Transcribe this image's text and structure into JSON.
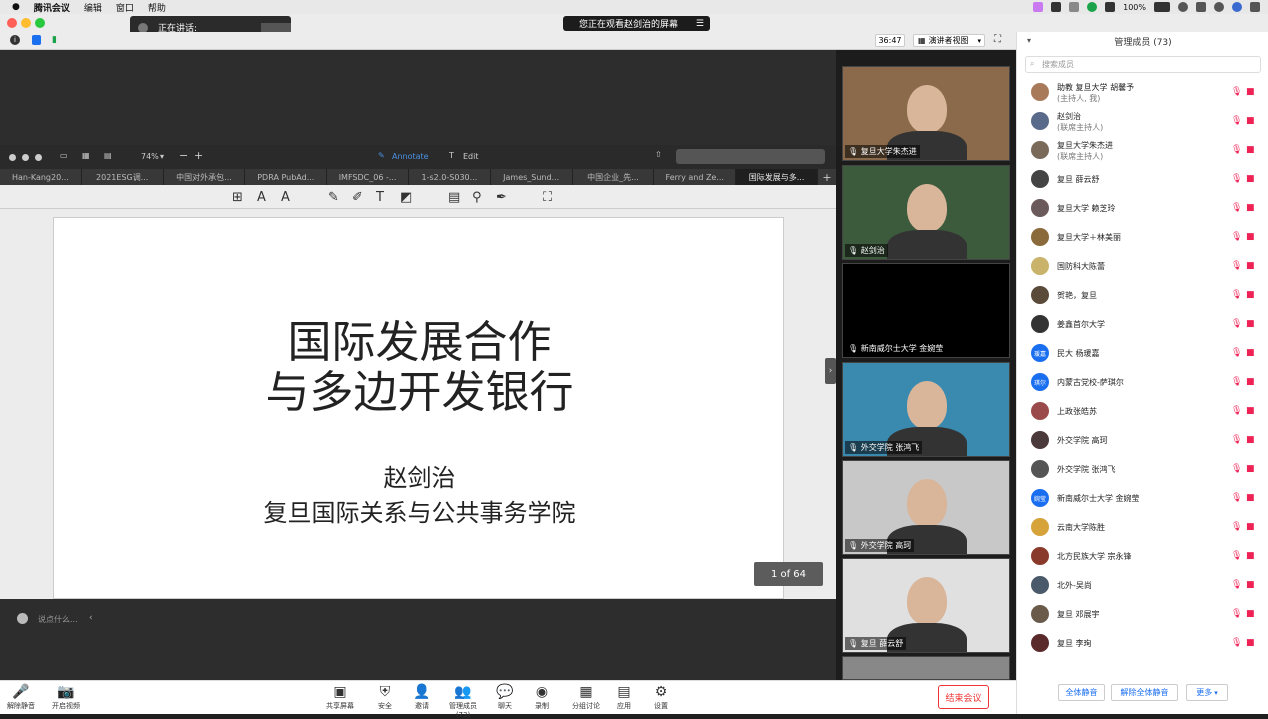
{
  "menubar": {
    "app": "腾讯会议",
    "items": [
      "编辑",
      "窗口",
      "帮助"
    ],
    "battery": "100%"
  },
  "speaking": {
    "label": "正在讲话:"
  },
  "viewing": {
    "text": "您正在观看赵剑治的屏幕"
  },
  "zoombar": {
    "timer": "36:47",
    "view_mode": "演讲者视图"
  },
  "preview": {
    "zoom": "74%",
    "annotate": "Annotate",
    "edit": "Edit",
    "tabs": [
      "Han-Kang20...",
      "2021ESG调...",
      "中国对外承包...",
      "PDRA PubAd...",
      "IMFSDC_06 -...",
      "1-s2.0-S030...",
      "James_Sund...",
      "中国企业_先...",
      "Ferry and Ze...",
      "国际发展与多..."
    ],
    "slide_title": "国际发展合作\n与多边开发银行",
    "slide_author": "赵剑治",
    "slide_school": "复旦国际关系与公共事务学院",
    "page": "1 of 64"
  },
  "chat": {
    "placeholder": "说点什么..."
  },
  "videos": [
    {
      "name": "复旦大学朱杰进",
      "mode": "person",
      "bg": "#8a6a4a"
    },
    {
      "name": "赵剑治",
      "mode": "person",
      "bg": "#3c5a3c"
    },
    {
      "name": "新南威尔士大学 金婉莹",
      "mode": "black",
      "bg": "#000000"
    },
    {
      "name": "外交学院 张鸿飞",
      "mode": "person",
      "bg": "#3a8ab0"
    },
    {
      "name": "外交学院 高珂",
      "mode": "person",
      "bg": "#c8c8c8"
    },
    {
      "name": "复旦 薛云舒",
      "mode": "person",
      "bg": "#e0e0e0"
    }
  ],
  "controls": [
    {
      "label": "解除静音",
      "icon": "mic-off-icon",
      "glyph": "🎤"
    },
    {
      "label": "开启视频",
      "icon": "video-off-icon",
      "glyph": "📷"
    },
    {
      "label": "共享屏幕",
      "icon": "share-screen-icon",
      "glyph": "▣"
    },
    {
      "label": "安全",
      "icon": "security-icon",
      "glyph": "⛨"
    },
    {
      "label": "邀请",
      "icon": "invite-icon",
      "glyph": "👤"
    },
    {
      "label": "管理成员(73)",
      "icon": "members-icon",
      "glyph": "👥"
    },
    {
      "label": "聊天",
      "icon": "chat-icon",
      "glyph": "💬"
    },
    {
      "label": "录制",
      "icon": "record-icon",
      "glyph": "◉"
    },
    {
      "label": "分组讨论",
      "icon": "breakout-icon",
      "glyph": "▦"
    },
    {
      "label": "应用",
      "icon": "apps-icon",
      "glyph": "▤"
    },
    {
      "label": "设置",
      "icon": "settings-icon",
      "glyph": "⚙"
    }
  ],
  "end_button": "结束会议",
  "panel": {
    "title": "管理成员 (73)",
    "search_placeholder": "搜索成员",
    "mute_all": "全体静音",
    "unmute_all": "解除全体静音",
    "more": "更多",
    "participants": [
      {
        "name": "助教 复旦大学 胡馨予",
        "role": "(主持人, 我)",
        "avatar": "",
        "color": "#a97a5a"
      },
      {
        "name": "赵剑治",
        "role": "(联席主持人)",
        "avatar": "",
        "color": "#5a6a8a"
      },
      {
        "name": "复旦大学朱杰进",
        "role": "(联席主持人)",
        "avatar": "",
        "color": "#7a6a5a"
      },
      {
        "name": "复旦 薛云舒",
        "role": "",
        "avatar": "",
        "color": "#444444"
      },
      {
        "name": "复旦大学 赖芝玲",
        "role": "",
        "avatar": "",
        "color": "#6a5a5a"
      },
      {
        "name": "复旦大学＋林美丽",
        "role": "",
        "avatar": "",
        "color": "#8a6a3a"
      },
      {
        "name": "国防科大陈蕾",
        "role": "",
        "avatar": "",
        "color": "#c9b26a"
      },
      {
        "name": "贺艳，复旦",
        "role": "",
        "avatar": "",
        "color": "#5a4a3a"
      },
      {
        "name": "姜鑫首尔大学",
        "role": "",
        "avatar": "",
        "color": "#333333"
      },
      {
        "name": "民大 杨瑗嘉",
        "role": "",
        "avatar": "瑗嘉",
        "color": "#1a6ef0"
      },
      {
        "name": "内蒙古党校-萨琪尔",
        "role": "",
        "avatar": "琪尔",
        "color": "#1a6ef0"
      },
      {
        "name": "上政张皓苏",
        "role": "",
        "avatar": "",
        "color": "#9a4a4a"
      },
      {
        "name": "外交学院 高珂",
        "role": "",
        "avatar": "",
        "color": "#4a3a3a"
      },
      {
        "name": "外交学院 张鸿飞",
        "role": "",
        "avatar": "",
        "color": "#555555"
      },
      {
        "name": "新南威尔士大学 金婉莹",
        "role": "",
        "avatar": "婉莹",
        "color": "#1a6ef0"
      },
      {
        "name": "云南大学陈胜",
        "role": "",
        "avatar": "",
        "color": "#d6a23a"
      },
      {
        "name": "北方民族大学 宗永锋",
        "role": "",
        "avatar": "",
        "color": "#8a3a2a"
      },
      {
        "name": "北外-吴尚",
        "role": "",
        "avatar": "",
        "color": "#4a5a6a"
      },
      {
        "name": "复旦 邓展宇",
        "role": "",
        "avatar": "",
        "color": "#6a5a4a"
      },
      {
        "name": "复旦 李珣",
        "role": "",
        "avatar": "",
        "color": "#5a2a2a"
      }
    ]
  }
}
